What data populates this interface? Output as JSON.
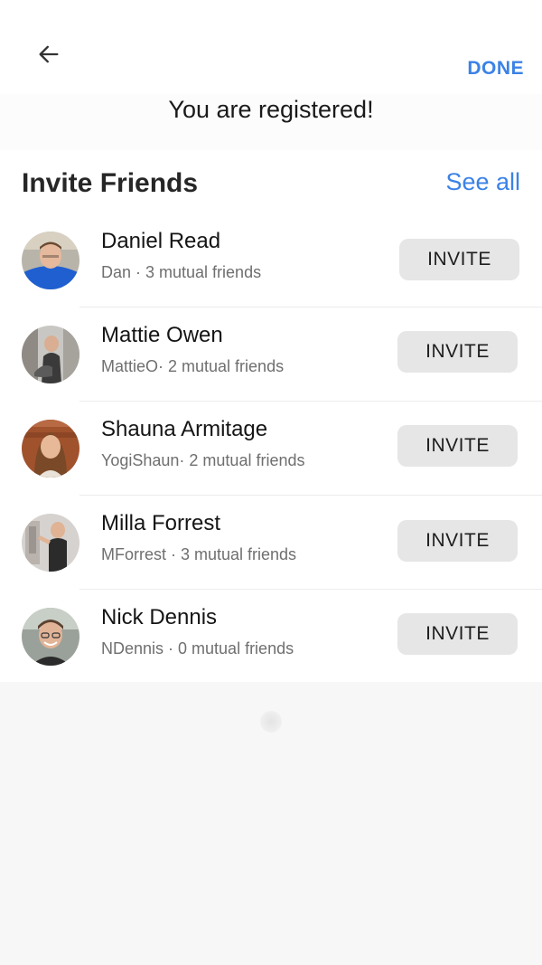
{
  "header": {
    "back_icon": "arrow-left-icon",
    "done_label": "DONE",
    "subtitle": "You are registered!"
  },
  "section": {
    "title": "Invite Friends",
    "see_all_label": "See all"
  },
  "friends": [
    {
      "name": "Daniel Read",
      "meta": "Dan · 3 mutual friends",
      "invite_label": "INVITE"
    },
    {
      "name": "Mattie Owen",
      "meta": "MattieO· 2 mutual friends",
      "invite_label": "INVITE"
    },
    {
      "name": "Shauna Armitage",
      "meta": "YogiShaun· 2 mutual friends",
      "invite_label": "INVITE"
    },
    {
      "name": "Milla Forrest",
      "meta": "MForrest · 3 mutual friends",
      "invite_label": "INVITE"
    },
    {
      "name": "Nick Dennis",
      "meta": "NDennis · 0 mutual friends",
      "invite_label": "INVITE"
    }
  ],
  "colors": {
    "accent": "#3b82e6",
    "button_bg": "#e6e6e6"
  }
}
